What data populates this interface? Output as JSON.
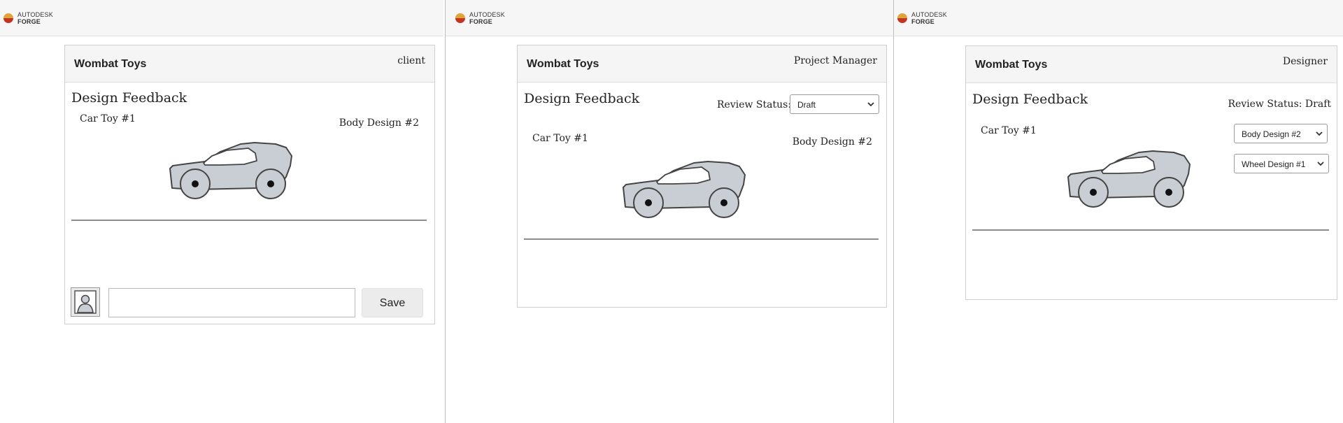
{
  "brand": {
    "line1": "AUTODESK",
    "line2": "FORGE"
  },
  "colors": {
    "car_body": "#c9ced4",
    "logo_top": "#e0a43a",
    "logo_bottom": "#c4351f"
  },
  "company": "Wombat Toys",
  "feedback_title": "Design Feedback",
  "project": "Car Toy #1",
  "client": {
    "role": "client",
    "body_design": "Body Design #2",
    "save_label": "Save",
    "comment_value": ""
  },
  "pm": {
    "role": "Project Manager",
    "review_status_label": "Review Status:",
    "review_status_value": "Draft",
    "body_design": "Body Design #2"
  },
  "designer": {
    "role": "Designer",
    "review_status_text": "Review Status: Draft",
    "body_design_select": "Body Design #2",
    "wheel_design_select": "Wheel Design #1"
  }
}
